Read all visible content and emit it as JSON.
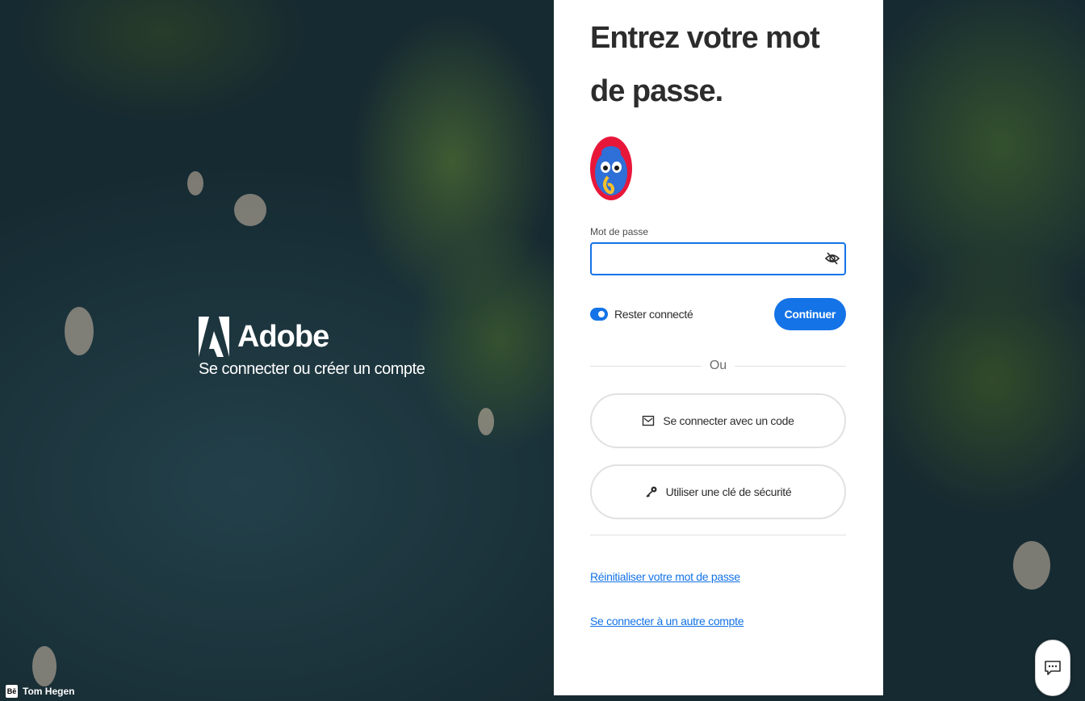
{
  "brand": {
    "name": "Adobe",
    "subtitle": "Se connecter ou créer un compte",
    "logo_icon": "adobe-logo-icon"
  },
  "credit": {
    "badge": "Bē",
    "author": "Tom Hegen"
  },
  "card": {
    "title": "Entrez votre mot de passe.",
    "avatar_icon": "user-avatar",
    "password": {
      "label": "Mot de passe",
      "value": "",
      "toggle_icon": "eye-off-icon"
    },
    "stay_signed_in": {
      "label": "Rester connecté",
      "checked": true
    },
    "continue_label": "Continuer",
    "divider_text": "Ou",
    "code_button_label": "Se connecter avec un code",
    "code_button_icon": "mail-icon",
    "key_button_label": "Utiliser une clé de sécurité",
    "key_button_icon": "key-icon",
    "reset_link": "Réinitialiser votre mot de passe",
    "other_account_link": "Se connecter à un autre compte"
  },
  "feedback_icon": "chat-icon",
  "colors": {
    "accent": "#1473e6",
    "card_bg": "#ffffff",
    "text": "#2c2c2c"
  }
}
